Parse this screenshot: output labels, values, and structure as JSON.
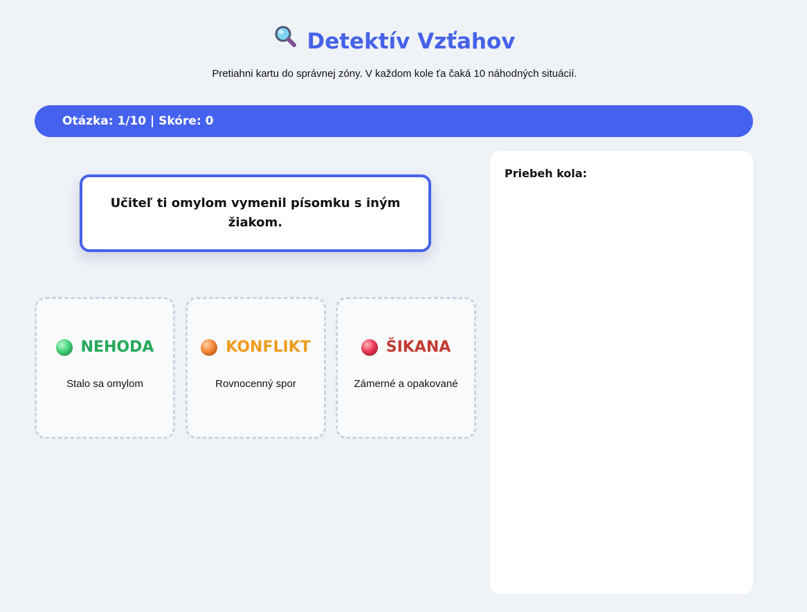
{
  "header": {
    "title_icon": "magnifying-glass-icon",
    "title": "Detektív Vzťahov",
    "subtitle": "Pretiahni kartu do správnej zóny. V každom kole ťa čaká 10 náhodných situácií."
  },
  "status": {
    "question_label": "Otázka:",
    "question_current": 1,
    "question_total": 10,
    "score_label": "Skóre:",
    "score": 0,
    "text": "Otázka: 1/10 | Skóre: 0"
  },
  "card": {
    "text": "Učiteľ ti omylom vymenil písomku s iným žiakom."
  },
  "zones": [
    {
      "dot_icon": "green-circle-icon",
      "title": "NEHODA",
      "description": "Stalo sa omylom",
      "color": "#27a85a"
    },
    {
      "dot_icon": "orange-circle-icon",
      "title": "KONFLIKT",
      "description": "Rovnocenný spor",
      "color": "#ef9b1a"
    },
    {
      "dot_icon": "red-circle-icon",
      "title": "ŠIKANA",
      "description": "Zámerné a opakované",
      "color": "#c13b32"
    }
  ],
  "progress": {
    "title": "Priebeh kola:",
    "items": []
  },
  "colors": {
    "accent": "#4562e8",
    "background": "#eff2f7"
  }
}
